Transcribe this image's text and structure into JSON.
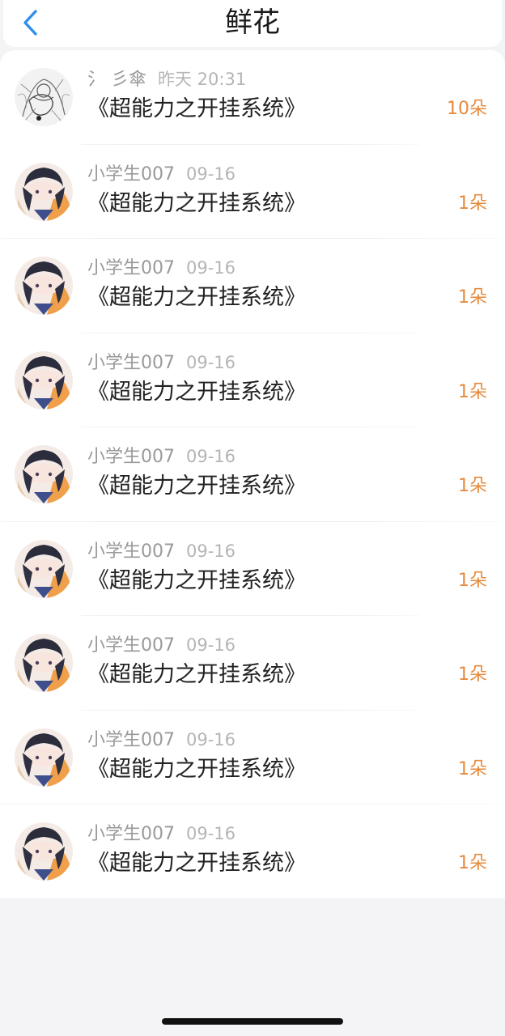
{
  "header": {
    "title": "鲜花",
    "back_icon": "chevron-left-icon",
    "accent": "#2f8ff0"
  },
  "colors": {
    "count": "#e68a3c",
    "meta": "#9a9a9a",
    "background": "#f4f4f6"
  },
  "items": [
    {
      "user": "氵 彡傘",
      "time": "昨天 20:31",
      "book": "《超能力之开挂系统》",
      "count": "10朵",
      "avatar": "sketch-avatar"
    },
    {
      "user": "小学生007",
      "time": "09-16",
      "book": "《超能力之开挂系统》",
      "count": "1朵",
      "avatar": "anime-avatar"
    },
    {
      "user": "小学生007",
      "time": "09-16",
      "book": "《超能力之开挂系统》",
      "count": "1朵",
      "avatar": "anime-avatar"
    },
    {
      "user": "小学生007",
      "time": "09-16",
      "book": "《超能力之开挂系统》",
      "count": "1朵",
      "avatar": "anime-avatar"
    },
    {
      "user": "小学生007",
      "time": "09-16",
      "book": "《超能力之开挂系统》",
      "count": "1朵",
      "avatar": "anime-avatar"
    },
    {
      "user": "小学生007",
      "time": "09-16",
      "book": "《超能力之开挂系统》",
      "count": "1朵",
      "avatar": "anime-avatar"
    },
    {
      "user": "小学生007",
      "time": "09-16",
      "book": "《超能力之开挂系统》",
      "count": "1朵",
      "avatar": "anime-avatar"
    },
    {
      "user": "小学生007",
      "time": "09-16",
      "book": "《超能力之开挂系统》",
      "count": "1朵",
      "avatar": "anime-avatar"
    },
    {
      "user": "小学生007",
      "time": "09-16",
      "book": "《超能力之开挂系统》",
      "count": "1朵",
      "avatar": "anime-avatar"
    }
  ]
}
